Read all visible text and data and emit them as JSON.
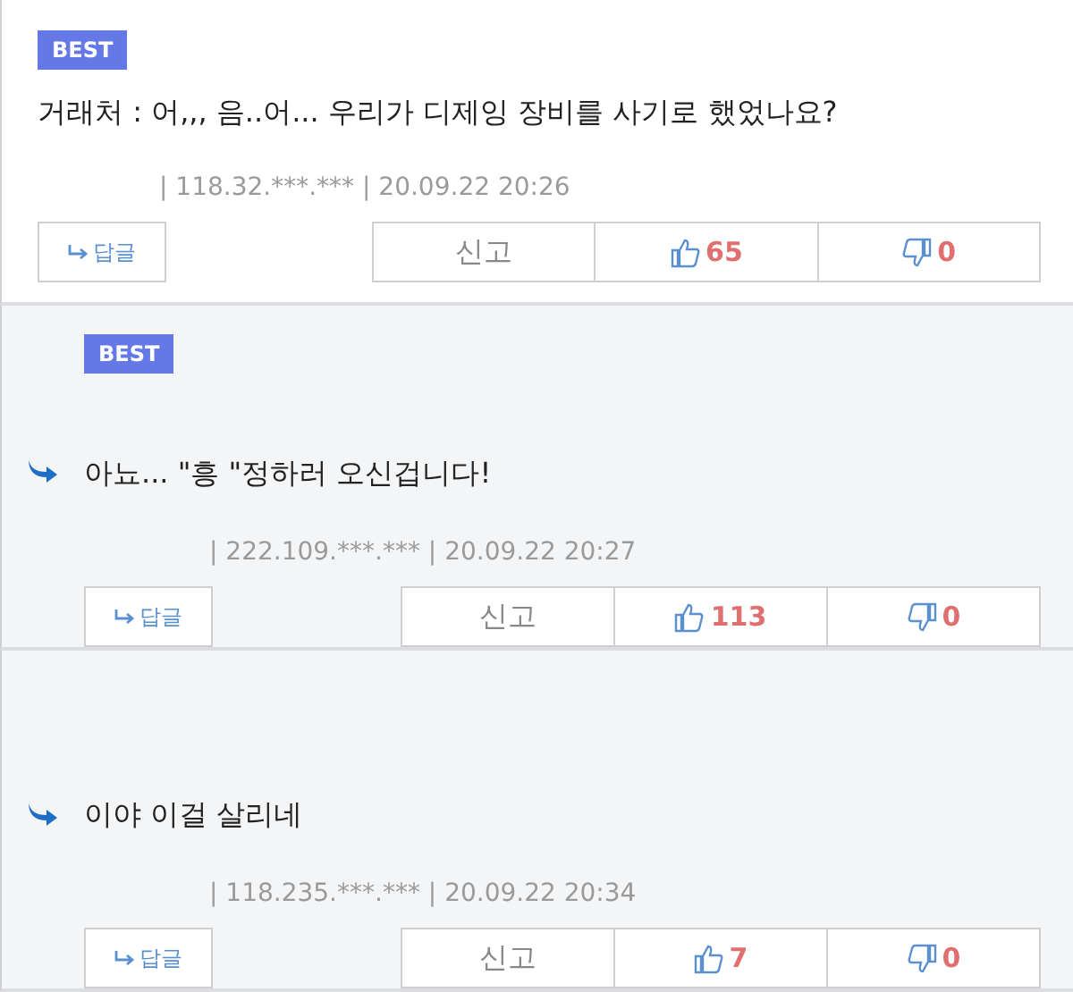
{
  "comments": [
    {
      "best": true,
      "is_reply": false,
      "badge": "BEST",
      "text": "거래처 : 어,,, 음..어... 우리가 디제잉 장비를 사기로 했었나요?",
      "ip": "| 118.32.***.*** | 20.09.22 20:26",
      "reply_label": "답글",
      "report": "신고",
      "likes": "65",
      "dislikes": "0"
    },
    {
      "best": true,
      "is_reply": true,
      "badge": "BEST",
      "text": "아뇨... \"흥 \"정하러 오신겁니다!",
      "ip": "| 222.109.***.*** | 20.09.22 20:27",
      "reply_label": "답글",
      "report": "신고",
      "likes": "113",
      "dislikes": "0"
    },
    {
      "best": false,
      "is_reply": true,
      "text": "이야 이걸 살리네",
      "ip": "| 118.235.***.*** | 20.09.22 20:34",
      "reply_label": "답글",
      "report": "신고",
      "likes": "7",
      "dislikes": "0"
    }
  ]
}
